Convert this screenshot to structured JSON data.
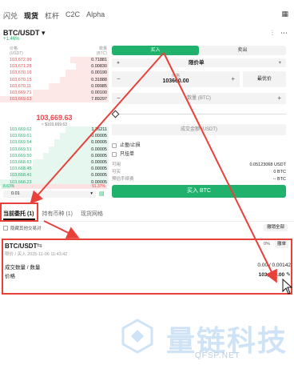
{
  "top_tabs": [
    "闪兑",
    "现货",
    "杠杆",
    "C2C",
    "Alpha"
  ],
  "top_tabs_active": 1,
  "pair": {
    "name": "BTC/USDT",
    "change": "+1.46%"
  },
  "orderbook": {
    "price_header": "价格",
    "price_unit": "(USDT)",
    "qty_header": "数量",
    "qty_unit": "(BTC)",
    "asks": [
      {
        "price": "103,672.99",
        "qty": "0.71881",
        "depth": 0.35
      },
      {
        "price": "103,671.28",
        "qty": "0.00830",
        "depth": 0.3
      },
      {
        "price": "103,670.16",
        "qty": "0.00190",
        "depth": 0.4
      },
      {
        "price": "103,670.15",
        "qty": "0.31888",
        "depth": 0.45
      },
      {
        "price": "103,670.11",
        "qty": "0.09985",
        "depth": 0.55
      },
      {
        "price": "103,669.71",
        "qty": "0.00100",
        "depth": 0.7
      },
      {
        "price": "103,669.63",
        "qty": "7.89297",
        "depth": 1.0
      }
    ],
    "mid_price": "103,669.63",
    "mid_sub": "≈ $103,669.63",
    "bids": [
      {
        "price": "103,669.62",
        "qty": "1.26211",
        "depth": 0.4
      },
      {
        "price": "103,669.61",
        "qty": "0.00005",
        "depth": 0.45
      },
      {
        "price": "103,669.54",
        "qty": "0.00005",
        "depth": 0.5
      },
      {
        "price": "103,669.51",
        "qty": "0.00005",
        "depth": 0.55
      },
      {
        "price": "103,669.50",
        "qty": "0.00005",
        "depth": 0.6
      },
      {
        "price": "103,668.63",
        "qty": "0.00005",
        "depth": 0.7
      },
      {
        "price": "103,668.45",
        "qty": "0.00005",
        "depth": 0.8
      },
      {
        "price": "103,668.41",
        "qty": "0.00005",
        "depth": 0.9
      },
      {
        "price": "103,668.23",
        "qty": "0.00005",
        "depth": 1.0
      }
    ],
    "buy_ratio": "8.63%",
    "sell_ratio": "91.37%",
    "buy_ratio_value": 0.0863,
    "depth_value": "0.01"
  },
  "form": {
    "buy_tab": "买入",
    "sell_tab": "卖出",
    "order_type": "限价单",
    "price_label": "价格",
    "price_value": "103660.00",
    "best_price": "最优价",
    "qty_placeholder": "数量 (BTC)",
    "amount_placeholder": "成交金额 (USDT)",
    "tp_sl": "止盈/止损",
    "post_only": "只挂单",
    "available_label": "可用",
    "available_value": "0.05123068 USDT",
    "max_label": "可买",
    "max_value": "0 BTC",
    "fee_label": "预估手续费",
    "fee_value": "-- BTC",
    "submit": "买入 BTC"
  },
  "orders": {
    "tabs": [
      "当前委托 (1)",
      "持有币种 (1)",
      "现货网格"
    ],
    "active_tab": 0,
    "hide_other_pairs": "隐藏其他交易对",
    "cancel_all": "撤销全部",
    "card": {
      "pair": "BTC/USDT",
      "pct": "0%",
      "cancel": "撤单",
      "meta": "限价 / 买入 2025-11-06 11:43:42",
      "filled_label": "成交数量 / 数量",
      "filled_value": "0.00 / 0.00142",
      "price_label": "价格",
      "price_value": "103,660.00"
    }
  },
  "watermark": {
    "text": "量链科技",
    "sub": "QFSP.NET"
  },
  "colors": {
    "buy": "#20b26c",
    "sell": "#ef454a",
    "annotation": "#e8413a",
    "watermark": "#cfe3f7"
  }
}
